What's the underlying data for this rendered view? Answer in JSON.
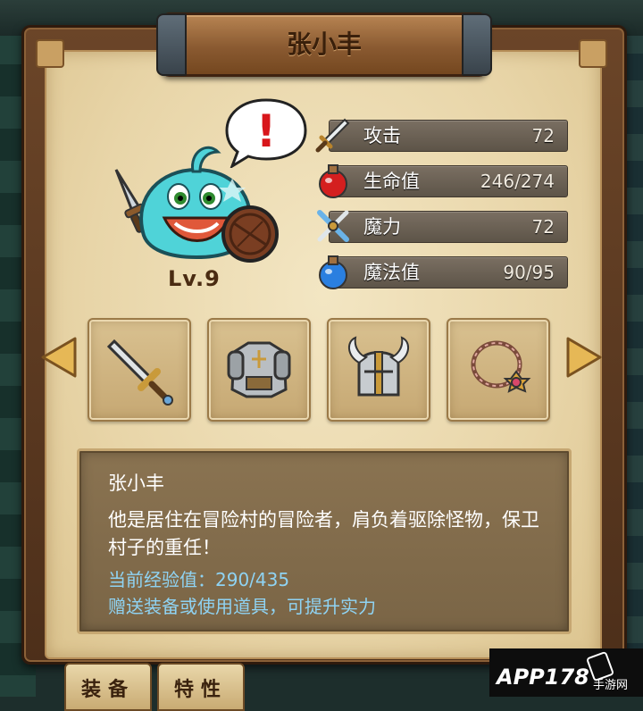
{
  "character": {
    "name": "张小丰",
    "level": "Lv.9",
    "alert_mark": "!"
  },
  "stats": [
    {
      "label": "攻击",
      "value": "72",
      "icon": "sword-icon"
    },
    {
      "label": "生命值",
      "value": "246/274",
      "icon": "red-potion-icon"
    },
    {
      "label": "魔力",
      "value": "72",
      "icon": "magic-sword-icon"
    },
    {
      "label": "魔法值",
      "value": "90/95",
      "icon": "blue-potion-icon"
    }
  ],
  "equipment": [
    {
      "slot": "weapon",
      "icon": "sword-icon"
    },
    {
      "slot": "armor",
      "icon": "armor-icon"
    },
    {
      "slot": "helmet",
      "icon": "winged-helmet-icon"
    },
    {
      "slot": "accessory",
      "icon": "amulet-icon"
    }
  ],
  "description": {
    "name": "张小丰",
    "text": "他是居住在冒险村的冒险者，肩负着驱除怪物，保卫村子的重任！",
    "exp": "当前经验值：290/435",
    "tip": "赠送装备或使用道具，可提升实力"
  },
  "tabs": [
    {
      "label": "装备"
    },
    {
      "label": "特性"
    }
  ],
  "watermark": {
    "main": "APP178",
    "sub": "手游网"
  },
  "colors": {
    "parchment": "#e8d5a8",
    "wood": "#8a5a31",
    "stat_bar": "#6b6256",
    "exp_text": "#8fd3f3"
  }
}
